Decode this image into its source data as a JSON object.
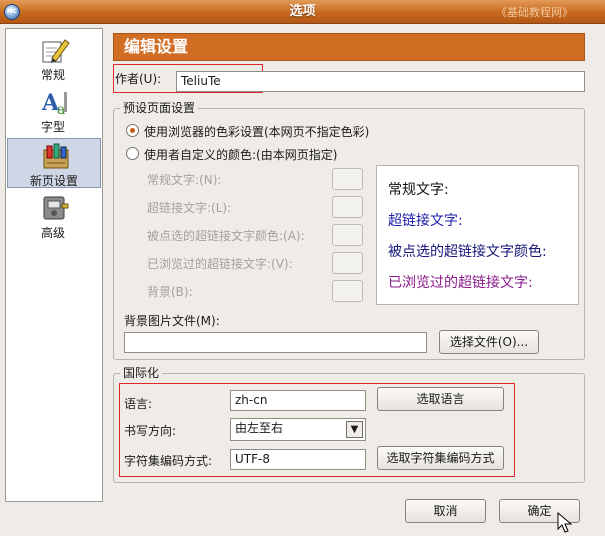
{
  "window": {
    "title": "选项",
    "watermark": "《基础教程网》"
  },
  "sidebar": {
    "items": [
      {
        "label": "常规",
        "icon": "pencil-paper-icon"
      },
      {
        "label": "字型",
        "icon": "font-letters-icon"
      },
      {
        "label": "新页设置",
        "icon": "page-settings-icon",
        "selected": true
      },
      {
        "label": "高级",
        "icon": "advanced-device-icon"
      }
    ]
  },
  "header": {
    "title": "编辑设置"
  },
  "author": {
    "label": "作者(U):",
    "value": "TeliuTe"
  },
  "page_defaults": {
    "title": "预设页面设置",
    "radio_browser": "使用浏览器的色彩设置(本网页不指定色彩)",
    "radio_custom": "使用者自定义的颜色:(由本网页指定)",
    "color_rows": [
      {
        "label": "常规文字:(N):"
      },
      {
        "label": "超链接文字:(L):"
      },
      {
        "label": "被点选的超链接文字颜色:(A):"
      },
      {
        "label": "已浏览过的超链接文字:(V):"
      },
      {
        "label": "背景(B):"
      }
    ],
    "preview": {
      "normal": "常规文字:",
      "link": "超链接文字:",
      "active": "被点选的超链接文字颜色:",
      "visited": "已浏览过的超链接文字:"
    },
    "bg_image_label": "背景图片文件(M):",
    "bg_image_value": "",
    "choose_file_button": "选择文件(O)..."
  },
  "i18n": {
    "title": "国际化",
    "language_label": "语言:",
    "language_value": "zh-cn",
    "choose_language_button": "选取语言",
    "direction_label": "书写方向:",
    "direction_value": "由左至右",
    "charset_label": "字符集编码方式:",
    "charset_value": "UTF-8",
    "choose_charset_button": "选取字符集编码方式"
  },
  "footer": {
    "cancel": "取消",
    "ok": "确定"
  },
  "colors": {
    "titlebar": "#c8681e",
    "header": "#d26d24",
    "highlight_border": "#e0282a",
    "preview_normal": "#111111",
    "preview_link": "#1c1ca8",
    "preview_active": "#16167a",
    "preview_visited": "#8a1a8a"
  }
}
